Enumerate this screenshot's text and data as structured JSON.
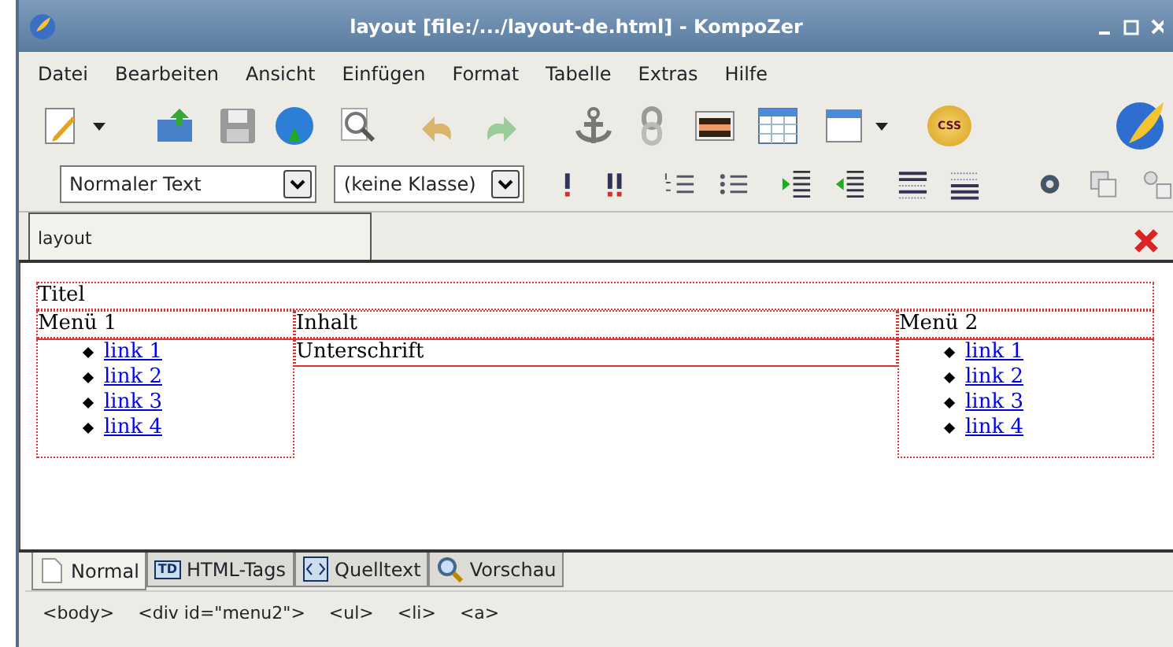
{
  "window": {
    "title": "layout [file:/.../layout-de.html] - KompoZer"
  },
  "menu": [
    "Datei",
    "Bearbeiten",
    "Ansicht",
    "Einfügen",
    "Format",
    "Tabelle",
    "Extras",
    "Hilfe"
  ],
  "format_toolbar": {
    "paragraph_format": "Normaler Text",
    "css_class": "(keine Klasse)"
  },
  "css_icon_text": "CSS",
  "document_tabs": [
    {
      "label": "layout",
      "selected": true
    }
  ],
  "page": {
    "title": "Titel",
    "menu_1": {
      "heading": "Menü 1",
      "links": [
        "link 1",
        "link 2",
        "link 3",
        "link 4"
      ]
    },
    "content": {
      "heading": "Inhalt",
      "caption": "Unterschrift"
    },
    "menu_2": {
      "heading": "Menü 2",
      "links": [
        "link 1",
        "link 2",
        "link 3",
        "link 4"
      ]
    }
  },
  "view_tabs": [
    {
      "label": "Normal",
      "kind": "page",
      "selected": true
    },
    {
      "label": "HTML-Tags",
      "kind": "tags",
      "icon_text": "TD",
      "selected": false
    },
    {
      "label": "Quelltext",
      "kind": "source",
      "selected": false
    },
    {
      "label": "Vorschau",
      "kind": "preview",
      "selected": false
    }
  ],
  "status_bar": {
    "tags": [
      "<body>",
      "<div id=\"menu2\">",
      "<ul>",
      "<li>",
      "<a>"
    ]
  }
}
